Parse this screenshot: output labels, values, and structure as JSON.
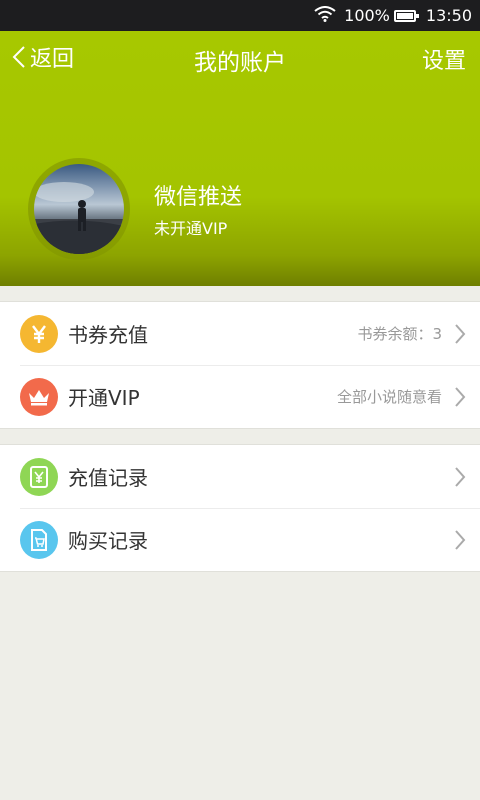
{
  "status_bar": {
    "battery": "100%",
    "time": "13:50"
  },
  "nav": {
    "back_label": "返回",
    "title": "我的账户",
    "settings_label": "设置"
  },
  "profile": {
    "name": "微信推送",
    "vip_status": "未开通VIP"
  },
  "colors": {
    "header": "#a6c600",
    "coin": "#f5b731",
    "vip": "#f26a4b",
    "record": "#8fd655",
    "purchase": "#59c6ee"
  },
  "menu_groups": [
    [
      {
        "label": "书券充值",
        "extra": "书券余额：3",
        "icon": "yen-coin-icon"
      },
      {
        "label": "开通VIP",
        "extra": "全部小说随意看",
        "icon": "crown-icon"
      }
    ],
    [
      {
        "label": "充值记录",
        "icon": "recharge-record-icon"
      },
      {
        "label": "购买记录",
        "icon": "purchase-record-icon"
      }
    ]
  ]
}
